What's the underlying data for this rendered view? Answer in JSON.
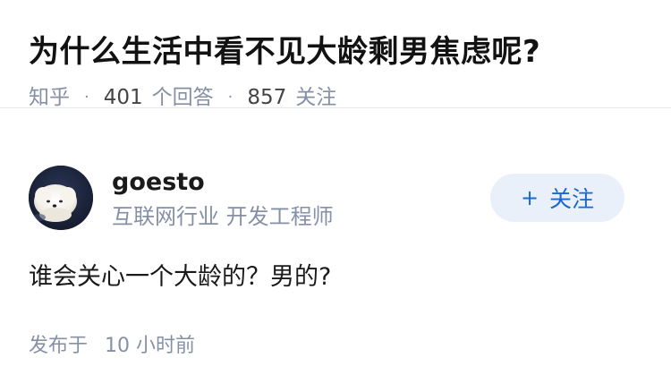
{
  "question": {
    "title": "为什么生活中看不见大龄剩男焦虑呢?",
    "source": "知乎",
    "answer_count": "401",
    "answer_label": "个回答",
    "follower_count": "857",
    "follower_label": "关注",
    "separator": "·"
  },
  "author": {
    "name": "goesto",
    "headline": "互联网行业 开发工程师",
    "avatar_icon": "pomeranian-dog-avatar",
    "follow_plus": "+",
    "follow_label": "关注"
  },
  "answer": {
    "content": "谁会关心一个大龄的？男的?",
    "published_label": "发布于",
    "published_time": "10 小时前"
  },
  "colors": {
    "meta_gray": "#8590a6",
    "follow_blue": "#1a67d2",
    "follow_bg": "#eaf0fa",
    "divider": "#ebebeb"
  }
}
